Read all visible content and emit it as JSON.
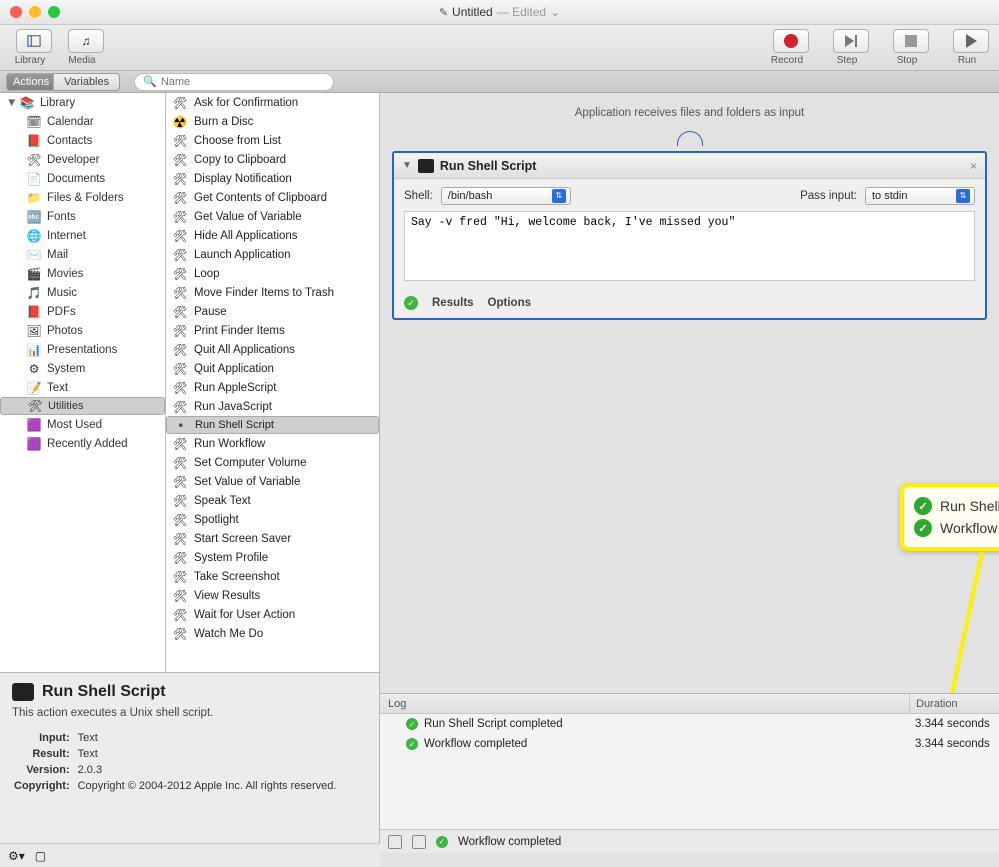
{
  "title": {
    "doc": "Untitled",
    "edited": "— Edited",
    "chev": "⌄"
  },
  "toolbar": {
    "library": "Library",
    "media": "Media",
    "record": "Record",
    "step": "Step",
    "stop": "Stop",
    "run": "Run",
    "tab_actions": "Actions",
    "tab_variables": "Variables",
    "search_placeholder": "Name"
  },
  "library": {
    "root": "Library",
    "items": [
      {
        "label": "Calendar",
        "icon": "🗓"
      },
      {
        "label": "Contacts",
        "icon": "📕"
      },
      {
        "label": "Developer",
        "icon": "🛠"
      },
      {
        "label": "Documents",
        "icon": "📄"
      },
      {
        "label": "Files & Folders",
        "icon": "📁"
      },
      {
        "label": "Fonts",
        "icon": "🔤"
      },
      {
        "label": "Internet",
        "icon": "🌐"
      },
      {
        "label": "Mail",
        "icon": "✉️"
      },
      {
        "label": "Movies",
        "icon": "🎬"
      },
      {
        "label": "Music",
        "icon": "🎵"
      },
      {
        "label": "PDFs",
        "icon": "📕"
      },
      {
        "label": "Photos",
        "icon": "🖼"
      },
      {
        "label": "Presentations",
        "icon": "📊"
      },
      {
        "label": "System",
        "icon": "⚙"
      },
      {
        "label": "Text",
        "icon": "📝"
      },
      {
        "label": "Utilities",
        "icon": "🛠",
        "selected": true
      },
      {
        "label": "Most Used",
        "icon": "🟪"
      },
      {
        "label": "Recently Added",
        "icon": "🟪"
      }
    ]
  },
  "actions": [
    "Ask for Confirmation",
    "Burn a Disc",
    "Choose from List",
    "Copy to Clipboard",
    "Display Notification",
    "Get Contents of Clipboard",
    "Get Value of Variable",
    "Hide All Applications",
    "Launch Application",
    "Loop",
    "Move Finder Items to Trash",
    "Pause",
    "Print Finder Items",
    "Quit All Applications",
    "Quit Application",
    "Run AppleScript",
    "Run JavaScript",
    "Run Shell Script",
    "Run Workflow",
    "Set Computer Volume",
    "Set Value of Variable",
    "Speak Text",
    "Spotlight",
    "Start Screen Saver",
    "System Profile",
    "Take Screenshot",
    "View Results",
    "Wait for User Action",
    "Watch Me Do"
  ],
  "actions_selected_index": 17,
  "receives": "Application receives files and folders as input",
  "card": {
    "title": "Run Shell Script",
    "shell_label": "Shell:",
    "shell_value": "/bin/bash",
    "pass_label": "Pass input:",
    "pass_value": "to stdin",
    "script": "Say -v fred \"Hi, welcome back, I've missed you\"",
    "results": "Results",
    "options": "Options"
  },
  "callout": {
    "l1": "Run Shell Script completed",
    "l2": "Workflow completed"
  },
  "log": {
    "h1": "Log",
    "h2": "Duration",
    "rows": [
      {
        "msg": "Run Shell Script completed",
        "dur": "3.344 seconds"
      },
      {
        "msg": "Workflow completed",
        "dur": "3.344 seconds"
      }
    ],
    "foot": "Workflow completed"
  },
  "info": {
    "title": "Run Shell Script",
    "desc": "This action executes a Unix shell script.",
    "input_l": "Input:",
    "input_v": "Text",
    "result_l": "Result:",
    "result_v": "Text",
    "version_l": "Version:",
    "version_v": "2.0.3",
    "copyright_l": "Copyright:",
    "copyright_v": "Copyright © 2004-2012 Apple Inc.  All rights reserved."
  }
}
